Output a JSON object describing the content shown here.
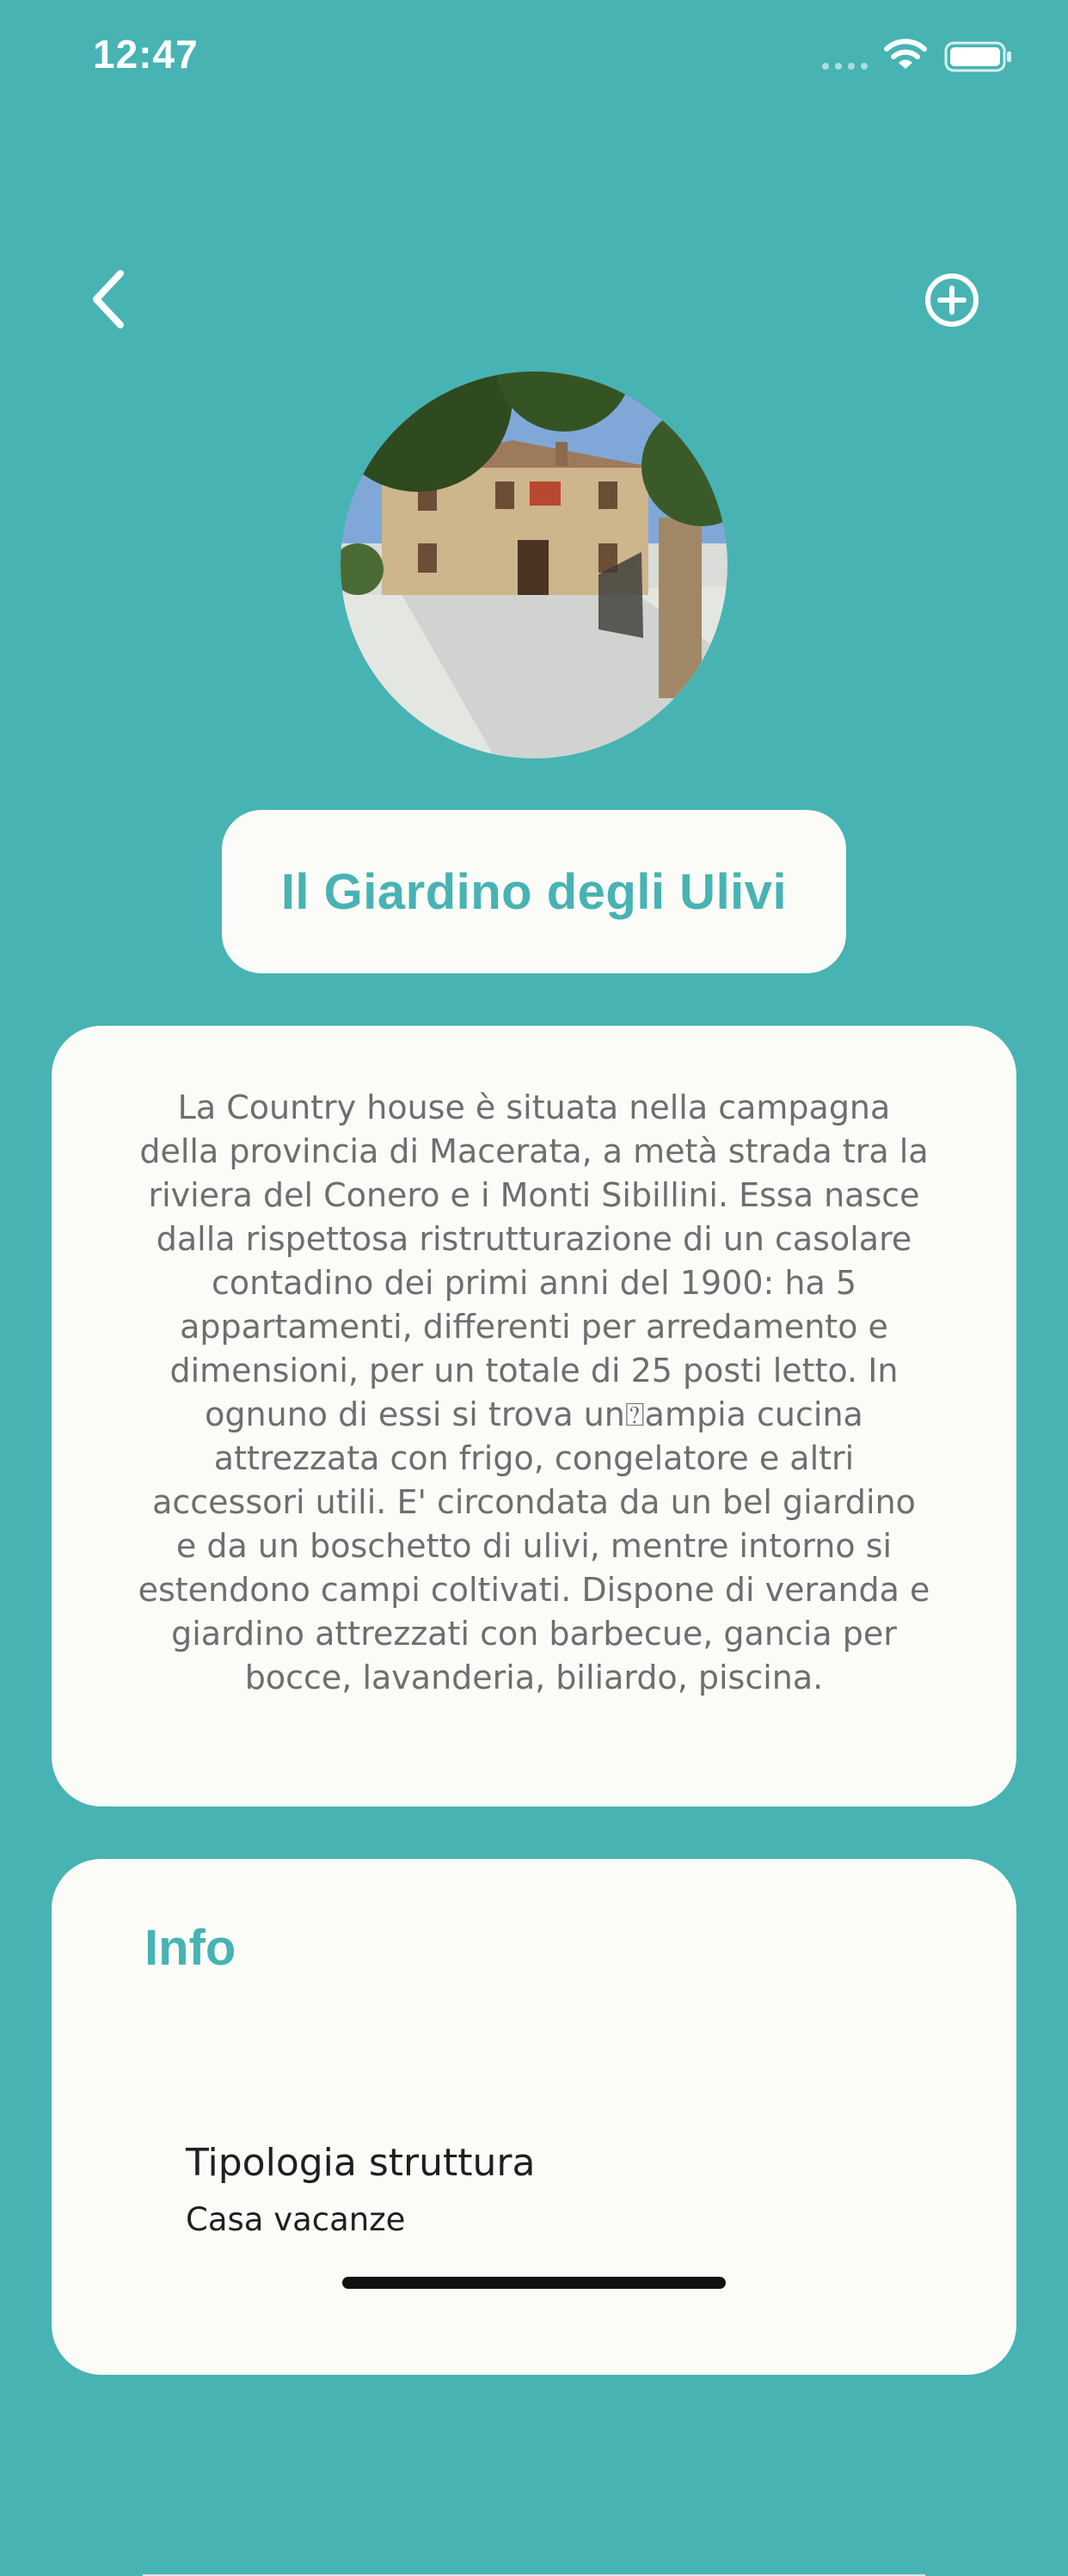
{
  "status_bar": {
    "time": "12:47",
    "icons": [
      "signal-icon",
      "wifi-icon",
      "battery-icon"
    ]
  },
  "nav": {
    "back_icon": "chevron-left-icon",
    "add_icon": "plus-circle-icon"
  },
  "property": {
    "name": "Il Giardino degli Ulivi",
    "description": "La Country house è situata nella campagna della provincia di Macerata, a metà strada tra la riviera del Conero e i Monti Sibillini. Essa nasce dalla rispettosa ristrutturazione di un casolare contadino dei primi anni del 1900: ha 5 appartamenti, differenti per arredamento e dimensioni, per un totale di 25 posti letto. In ognuno di essi si trova un⍰ampia cucina attrezzata con frigo, congelatore e altri accessori utili. E' circondata da un bel giardino e da un boschetto di ulivi, mentre intorno si estendono campi coltivati. Dispone di veranda e giardino attrezzati con barbecue, gancia per bocce, lavanderia, biliardo, piscina."
  },
  "info": {
    "heading": "Info",
    "rows": [
      {
        "label": "Tipologia struttura",
        "value": "Casa vacanze"
      }
    ]
  },
  "colors": {
    "accent": "#48b3b3",
    "card": "#fbfcf8",
    "body_text": "#6e6e6e"
  }
}
